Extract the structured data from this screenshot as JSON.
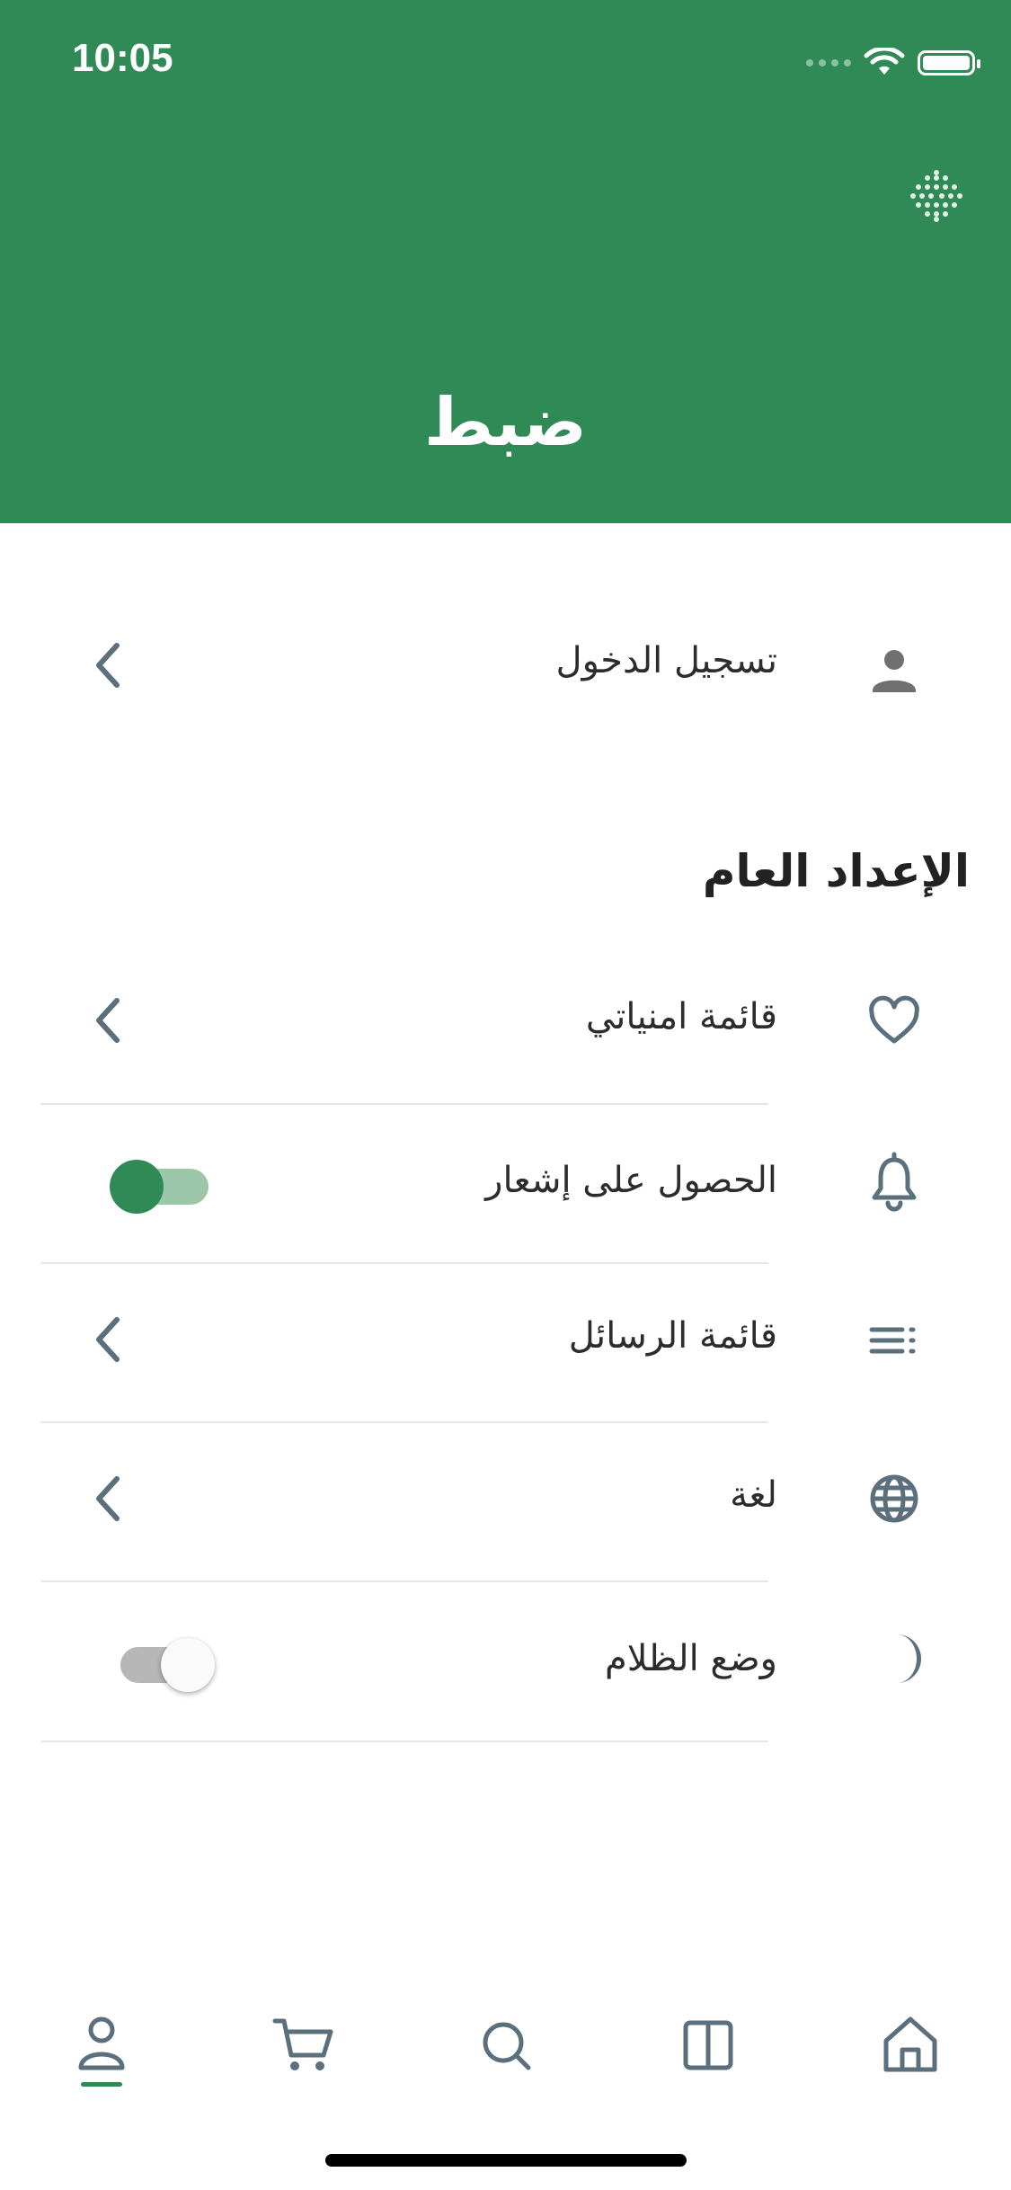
{
  "status_bar": {
    "time": "10:05"
  },
  "header": {
    "title": "ضبط"
  },
  "login": {
    "label": "تسجيل الدخول"
  },
  "general": {
    "title": "الإعداد العام",
    "items": [
      {
        "label": "قائمة امنياتي",
        "icon": "heart-icon",
        "control": "chevron"
      },
      {
        "label": "الحصول على إشعار",
        "icon": "bell-icon",
        "control": "toggle",
        "value": true
      },
      {
        "label": "قائمة الرسائل",
        "icon": "list-icon",
        "control": "chevron"
      },
      {
        "label": "لغة",
        "icon": "globe-icon",
        "control": "chevron"
      },
      {
        "label": "وضع الظلام",
        "icon": "moon-icon",
        "control": "toggle",
        "value": false
      }
    ]
  },
  "tabbar": {
    "tabs": [
      "profile-icon",
      "cart-icon",
      "search-icon",
      "book-icon",
      "home-icon"
    ],
    "active": "profile-icon"
  },
  "colors": {
    "primary": "#2f8a55",
    "icon": "#5b6f7d"
  }
}
